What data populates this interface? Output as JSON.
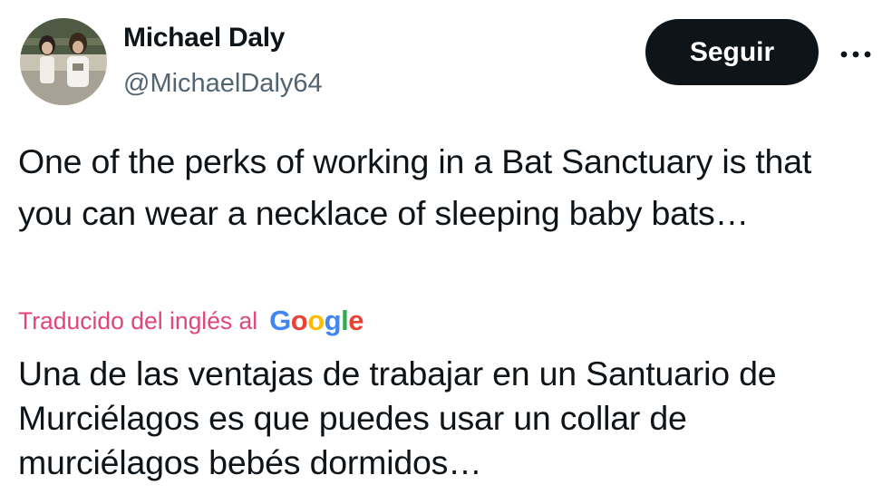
{
  "user": {
    "display_name": "Michael Daly",
    "handle": "@MichaelDaly64"
  },
  "actions": {
    "follow_label": "Seguir",
    "more_icon": "more-horizontal-icon"
  },
  "tweet": {
    "text": "One of the perks of working in a Bat Sanctuary is that you can wear a necklace of sleeping baby bats…"
  },
  "translation": {
    "label": "Traducido del inglés al",
    "provider": "Google",
    "text": "Una de las ventajas de trabajar en un Santuario de Murciélagos es que puedes usar un collar de murciélagos bebés dormidos…"
  },
  "colors": {
    "text": "#0f1419",
    "secondary": "#536471",
    "button_bg": "#0f1419",
    "translated_label": "#e0457b"
  }
}
